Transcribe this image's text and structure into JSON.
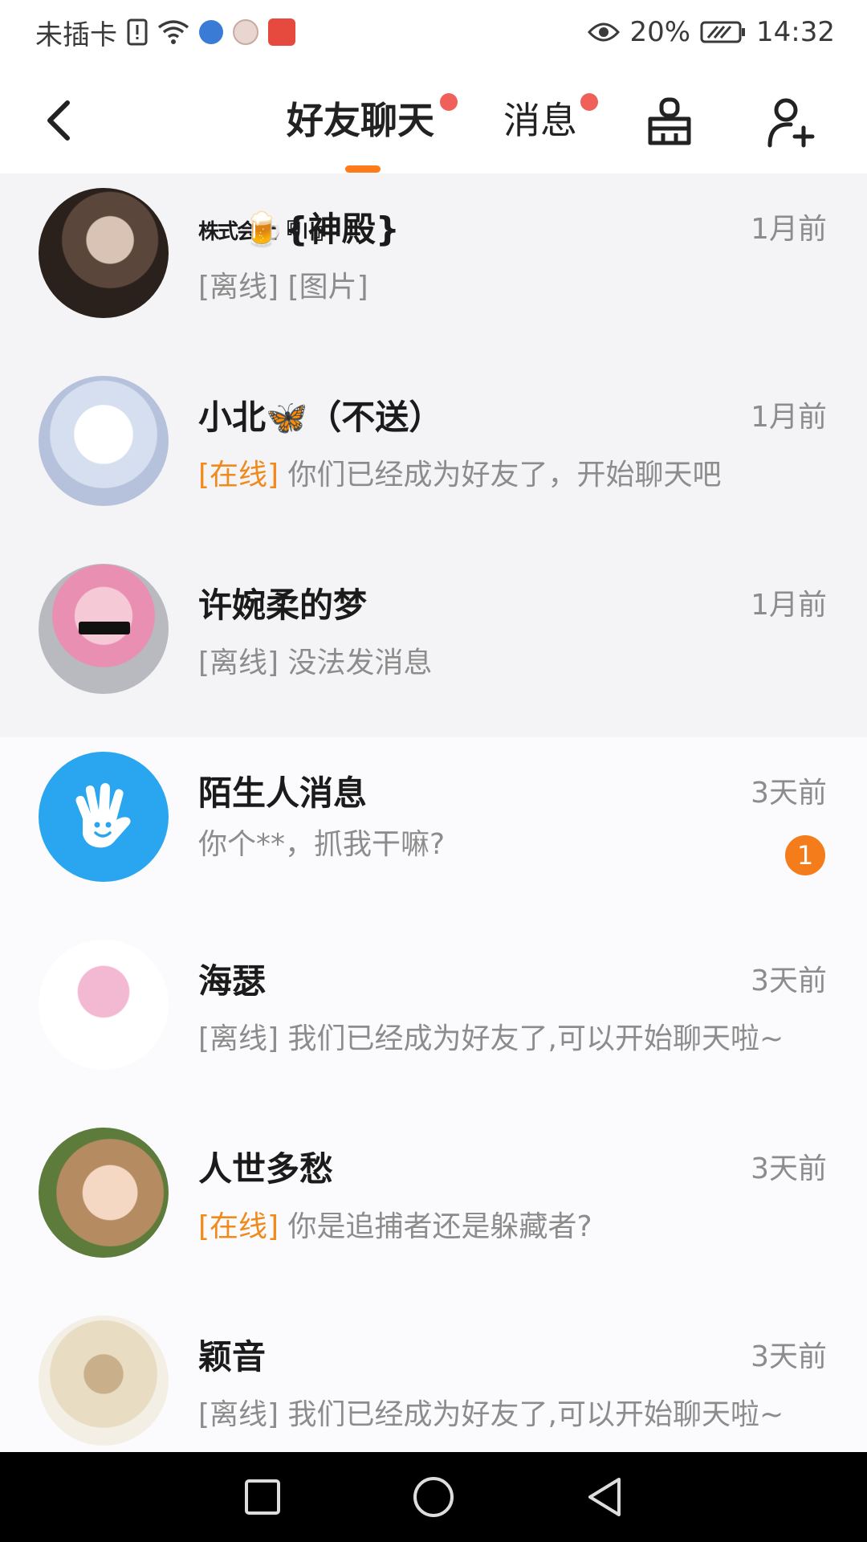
{
  "status_bar": {
    "carrier": "未插卡",
    "battery_percent": "20%",
    "time": "14:32"
  },
  "nav": {
    "tabs": [
      {
        "label": "好友聊天",
        "active": true,
        "has_dot": true
      },
      {
        "label": "消息",
        "active": false,
        "has_dot": true
      }
    ],
    "accent_color": "#ff7a1a",
    "dot_color": "#f0605a"
  },
  "conversations": [
    {
      "name": "🍺{神殿}",
      "name_prefix": "株式会社『川』",
      "time": "1月前",
      "status": "[离线]",
      "online": false,
      "preview": "[图片]",
      "pinned": true,
      "avatar_color": "#3b3028"
    },
    {
      "name": "小北🦋（不送）",
      "time": "1月前",
      "status": "[在线]",
      "online": true,
      "preview": "你们已经成为好友了，开始聊天吧",
      "pinned": true,
      "avatar_color": "#dfe6f2"
    },
    {
      "name": "许婉柔的梦",
      "time": "1月前",
      "status": "[离线]",
      "online": false,
      "preview": "没法发消息",
      "pinned": true,
      "avatar_color": "#c6c6cc"
    },
    {
      "name": "陌生人消息",
      "time": "3天前",
      "status": "",
      "online": false,
      "preview": "你个**，抓我干嘛?",
      "pinned": false,
      "badge": "1",
      "avatar_color": "#2aa6f0"
    },
    {
      "name": "海瑟",
      "time": "3天前",
      "status": "[离线]",
      "online": false,
      "preview": "我们已经成为好友了,可以开始聊天啦~",
      "pinned": false,
      "avatar_color": "#f7e3ef"
    },
    {
      "name": "人世多愁",
      "time": "3天前",
      "status": "[在线]",
      "online": true,
      "preview": "你是追捕者还是躲藏者?",
      "pinned": false,
      "avatar_color": "#d7a67a"
    },
    {
      "name": "颖音",
      "time": "3天前",
      "status": "[离线]",
      "online": false,
      "preview": "我们已经成为好友了,可以开始聊天啦~",
      "pinned": false,
      "avatar_color": "#efe7d6"
    }
  ]
}
